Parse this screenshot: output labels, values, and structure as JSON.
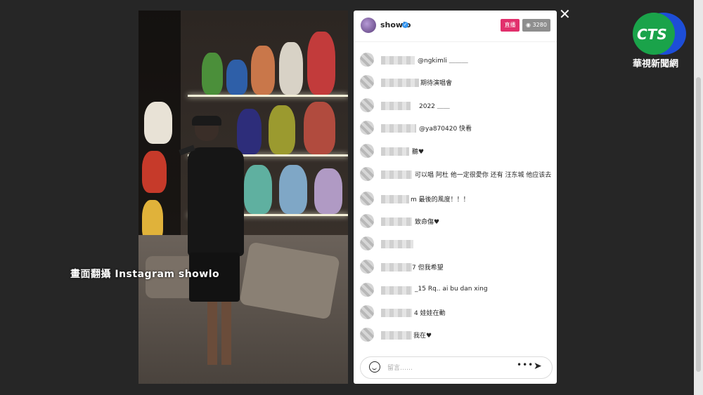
{
  "caption": "畫面翻攝 Instagram showlo",
  "panel": {
    "username": "showlo",
    "live_label": "直播",
    "viewer_count": "3280",
    "comments": [
      {
        "text": "@ngkimli ＿＿＿"
      },
      {
        "text": "期待演唱會"
      },
      {
        "text": "2022 ＿＿"
      },
      {
        "text": "@ya870420 快看"
      },
      {
        "text": "聽♥"
      },
      {
        "text": "可以唱 阿杜 他一定很愛你 还有 汪东城 他应该去"
      },
      {
        "text": "m 最後的風度！！！"
      },
      {
        "text": "致命傷♥"
      },
      {
        "text": ""
      },
      {
        "text": "7 但我希望"
      },
      {
        "text": "_15 Rq.. ai bu dan xing"
      },
      {
        "text": "4 娃娃在動"
      },
      {
        "text": "我在♥"
      }
    ],
    "input_placeholder": "留言……",
    "more_label": "•••",
    "send_label": "➤"
  },
  "close_label": "✕",
  "logo": {
    "name": "CTS",
    "subtitle": "華視新聞網"
  },
  "colors": {
    "live": "#e1306c",
    "verified": "#3897f0"
  }
}
